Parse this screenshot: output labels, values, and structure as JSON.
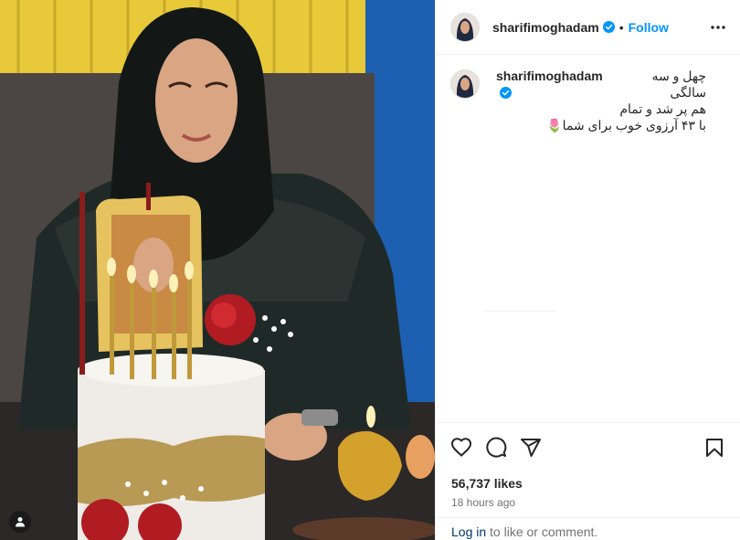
{
  "post": {
    "username": "sharifimoghadam",
    "follow_label": "Follow",
    "separator": "•",
    "caption": {
      "line1": "چهل و سه سالگی",
      "line2": "هم پر شد و تمام",
      "line3": "با ۴۳ آرزوی خوب برای شما🌷"
    },
    "likes": "56,737 likes",
    "time_ago": "18 hours ago",
    "login_link": "Log in",
    "login_text": " to like or comment."
  },
  "icons": {
    "verified": "verified-badge-icon",
    "more": "more-options-icon",
    "like": "heart-icon",
    "comment": "comment-icon",
    "share": "share-icon",
    "save": "bookmark-icon",
    "tag": "person-tag-icon"
  },
  "colors": {
    "accent": "#0095f6",
    "link": "#00376b",
    "muted": "#737373",
    "text": "#262626"
  }
}
